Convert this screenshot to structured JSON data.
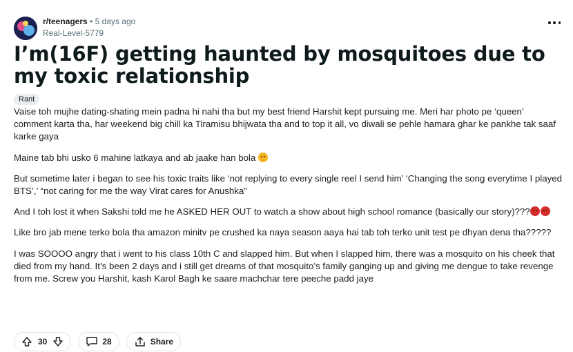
{
  "post": {
    "subreddit": "r/teenagers",
    "separator": "•",
    "time": "5 days ago",
    "author": "Real-Level-5779",
    "title": "I’m(16F) getting haunted by mosquitoes due to my toxic relationship",
    "flair": "Rant",
    "paragraphs": [
      "Vaise toh mujhe dating-shating mein padna hi nahi tha but my best friend Harshit kept pursuing me. Meri har photo pe ‘queen’ comment karta tha, har weekend big chill ka Tiramisu bhijwata tha and to top it all, vo diwali se pehle hamara ghar ke pankhe tak saaf karke gaya",
      "Maine tab bhi usko 6 mahine latkaya and ab jaake han bola",
      "But sometime later i began to see his toxic traits like ‘not replying to every single reel I send him’ ‘Changing the song everytime I played BTS’,’ “not caring for me the way Virat cares for Anushka”",
      "And I toh lost it when Sakshi told me he ASKED HER OUT to watch a show about high school romance (basically our story)???",
      "Like bro jab mene terko bola tha amazon minitv pe crushed ka naya season aaya hai tab toh terko unit test pe dhyan dena tha?????",
      "I was SOOOO angry that i went to his class 10th C and slapped him. But when I slapped him, there was a mosquito on his cheek that died from my hand. It’s been 2 days and i still get dreams of that mosquito’s family ganging up and giving me dengue to take revenge from me. Screw you Harshit, kash Karol Bagh ke saare machchar tere peeche padd jaye"
    ]
  },
  "actions": {
    "votes": "30",
    "comments": "28",
    "share_label": "Share"
  },
  "icons": {
    "avatar": "subreddit-avatar",
    "more": "more-options-icon",
    "upvote": "upvote-icon",
    "downvote": "downvote-icon",
    "comment": "comment-icon",
    "share": "share-icon",
    "emoji_smile": "heart-eyes-emoji",
    "emoji_angry": "angry-face-emoji"
  },
  "colors": {
    "meta_gray": "#576f76",
    "flair_bg": "#eaedef",
    "border": "#dfe3e5"
  }
}
